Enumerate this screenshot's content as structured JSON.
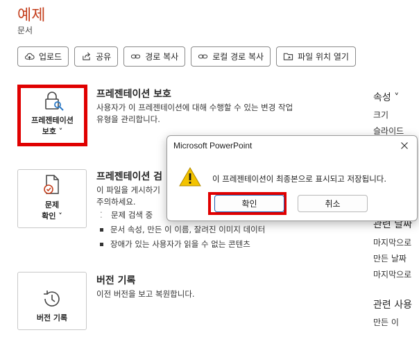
{
  "header": {
    "title": "예제",
    "subtitle": "문서"
  },
  "toolbar": {
    "upload": "업로드",
    "share": "공유",
    "copy_path": "경로 복사",
    "copy_local_path": "로컬 경로 복사",
    "open_file_location": "파일 위치 열기"
  },
  "protect": {
    "card_label_line1": "프레젠테이션",
    "card_label_line2": "보호 ˅",
    "title": "프레젠테이션 보호",
    "desc_line1": "사용자가 이 프레젠테이션에 대해 수행할 수 있는 변경 작업",
    "desc_line2": "유형을 관리합니다."
  },
  "inspect": {
    "card_label_line1": "문제",
    "card_label_line2": "확인 ˅",
    "title": "프레젠테이션 검",
    "desc_line1": "이 파일을 게시하기",
    "desc_line2": "주의하세요.",
    "bullets": [
      "문제 검색 중",
      "문서 속성, 만든 이 이름, 잘려진 이미지 데이터",
      "장애가 있는 사용자가 읽을 수 없는 콘텐츠"
    ]
  },
  "history": {
    "card_label": "버전 기록",
    "title": "버전 기록",
    "desc": "이전 버전을 보고 복원합니다."
  },
  "right": {
    "properties_head": "속성 ˅",
    "size": "크기",
    "slides": "슬라이드",
    "related_dates_head": "관련 날짜",
    "last_modified": "마지막으로 ",
    "created": "만든 날짜",
    "last_printed": "마지막으로 ",
    "related_people_head": "관련 사용",
    "author": "만든 이"
  },
  "dialog": {
    "title": "Microsoft PowerPoint",
    "message": "이 프레젠테이션이 최종본으로 표시되고 저장됩니다.",
    "ok": "확인",
    "cancel": "취소"
  },
  "colors": {
    "accent": "#c43e1c",
    "highlight": "#e00000",
    "warning": "#f3c300"
  }
}
